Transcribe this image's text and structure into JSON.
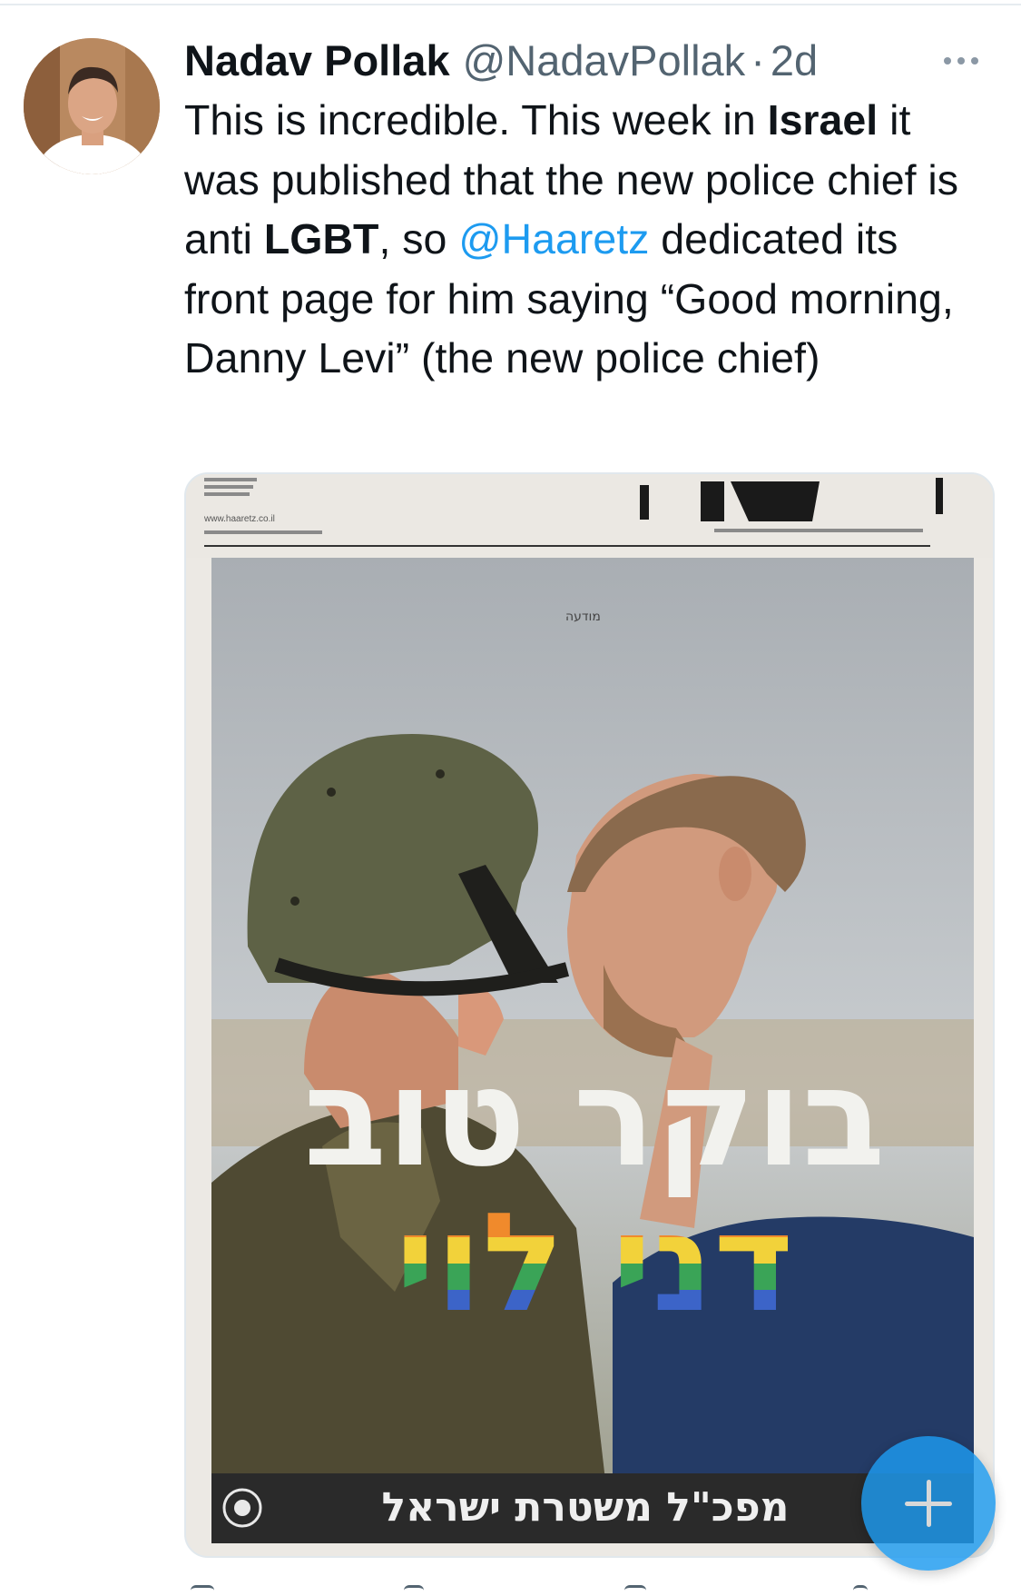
{
  "tweet": {
    "author": {
      "display_name": "Nadav Pollak",
      "handle": "@NadavPollak",
      "separator": "·",
      "age": "2d"
    },
    "text_segments": [
      {
        "text": "This is incredible. This week in ",
        "style": "normal"
      },
      {
        "text": "Israel",
        "style": "bold"
      },
      {
        "text": " it was published that the new police chief is anti ",
        "style": "normal"
      },
      {
        "text": "LGBT",
        "style": "bold"
      },
      {
        "text": ", so ",
        "style": "normal"
      },
      {
        "text": "@Haaretz",
        "style": "mention"
      },
      {
        "text": " dedicated its front page for him saying “Good morning, Danny Levi” (the new police chief)",
        "style": "normal"
      }
    ],
    "more_icon": "more-horizontal-icon"
  },
  "newspaper": {
    "website": "www.haaretz.co.il",
    "ad_label": "מודעה",
    "headline_line1": "בוקר טוב",
    "headline_line2": "דני לוי",
    "footer_text": "מפכ\"ל משטרת ישראל"
  },
  "fab": {
    "icon": "plus-icon",
    "color": "#1d9bf0"
  },
  "colors": {
    "text": "#0f1419",
    "secondary": "#536471",
    "link": "#1d9bf0",
    "rainbow": [
      "#e2403a",
      "#f08a2c",
      "#f2d23a",
      "#3aa457",
      "#3c64c8",
      "#7a4bb0"
    ]
  }
}
